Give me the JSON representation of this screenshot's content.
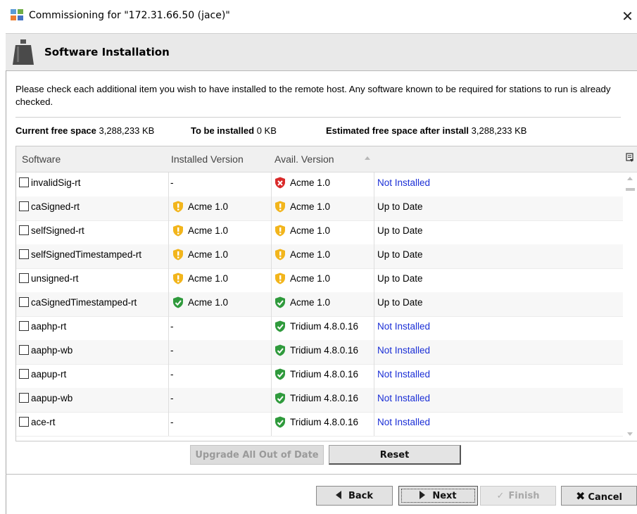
{
  "window": {
    "title": "Commissioning for \"172.31.66.50 (jace)\"",
    "close_glyph": "✕"
  },
  "banner": {
    "title": "Software Installation",
    "icon": "weight-icon"
  },
  "instructions": "Please check each additional item you wish to have installed to the remote host. Any software known to be required for stations to run is already checked.",
  "space": {
    "current_label": "Current free space",
    "current_value": "3,288,233 KB",
    "tobe_label": "To be installed",
    "tobe_value": "0 KB",
    "estimated_label": "Estimated free space after install",
    "estimated_value": "3,288,233 KB"
  },
  "table": {
    "columns": [
      "Software",
      "Installed Version",
      "Avail. Version",
      ""
    ],
    "sort_column": "Avail. Version",
    "rows": [
      {
        "name": "invalidSig-rt",
        "installed": "-",
        "installed_icon": "",
        "avail": "Acme 1.0",
        "avail_icon": "red",
        "status": "Not Installed",
        "status_blue": true
      },
      {
        "name": "caSigned-rt",
        "installed": "Acme 1.0",
        "installed_icon": "yellow",
        "avail": "Acme 1.0",
        "avail_icon": "yellow",
        "status": "Up to Date",
        "status_blue": false
      },
      {
        "name": "selfSigned-rt",
        "installed": "Acme 1.0",
        "installed_icon": "yellow",
        "avail": "Acme 1.0",
        "avail_icon": "yellow",
        "status": "Up to Date",
        "status_blue": false
      },
      {
        "name": "selfSignedTimestamped-rt",
        "installed": "Acme 1.0",
        "installed_icon": "yellow",
        "avail": "Acme 1.0",
        "avail_icon": "yellow",
        "status": "Up to Date",
        "status_blue": false
      },
      {
        "name": "unsigned-rt",
        "installed": "Acme 1.0",
        "installed_icon": "yellow",
        "avail": "Acme 1.0",
        "avail_icon": "yellow",
        "status": "Up to Date",
        "status_blue": false
      },
      {
        "name": "caSignedTimestamped-rt",
        "installed": "Acme 1.0",
        "installed_icon": "green",
        "avail": "Acme 1.0",
        "avail_icon": "green",
        "status": "Up to Date",
        "status_blue": false
      },
      {
        "name": "aaphp-rt",
        "installed": "-",
        "installed_icon": "",
        "avail": "Tridium 4.8.0.16",
        "avail_icon": "green",
        "status": "Not Installed",
        "status_blue": true
      },
      {
        "name": "aaphp-wb",
        "installed": "-",
        "installed_icon": "",
        "avail": "Tridium 4.8.0.16",
        "avail_icon": "green",
        "status": "Not Installed",
        "status_blue": true
      },
      {
        "name": "aapup-rt",
        "installed": "-",
        "installed_icon": "",
        "avail": "Tridium 4.8.0.16",
        "avail_icon": "green",
        "status": "Not Installed",
        "status_blue": true
      },
      {
        "name": "aapup-wb",
        "installed": "-",
        "installed_icon": "",
        "avail": "Tridium 4.8.0.16",
        "avail_icon": "green",
        "status": "Not Installed",
        "status_blue": true
      },
      {
        "name": "ace-rt",
        "installed": "-",
        "installed_icon": "",
        "avail": "Tridium 4.8.0.16",
        "avail_icon": "green",
        "status": "Not Installed",
        "status_blue": true
      }
    ]
  },
  "buttons": {
    "upgrade": "Upgrade All Out of Date",
    "reset": "Reset",
    "back": "Back",
    "next": "Next",
    "finish": "Finish",
    "cancel": "Cancel"
  },
  "colors": {
    "link_blue": "#1b2fd6",
    "shield_red": "#d92a2a",
    "shield_yellow": "#f2b51c",
    "shield_green": "#2f9a3c"
  }
}
